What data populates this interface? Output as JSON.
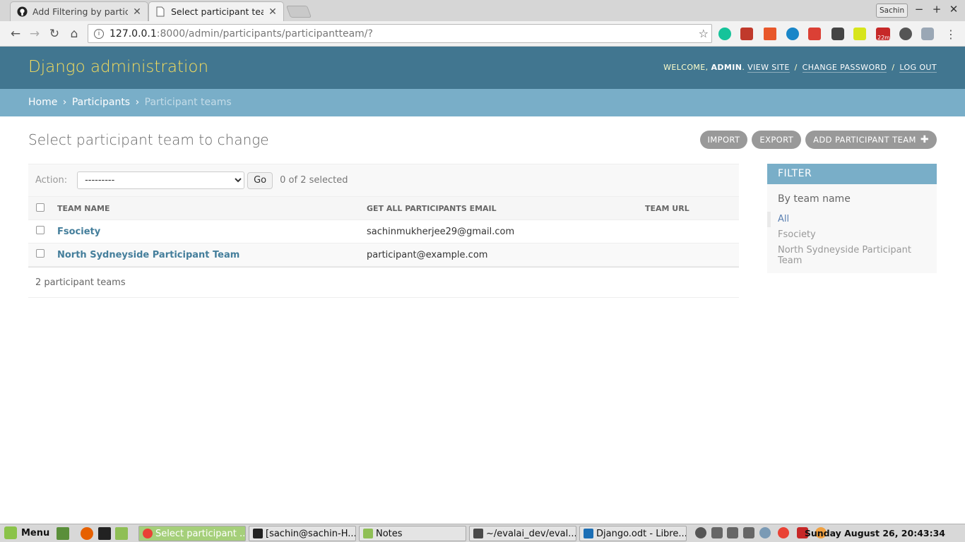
{
  "browser": {
    "tabs": [
      {
        "label": "Add Filtering by particip",
        "close": "✕"
      },
      {
        "label": "Select participant team t",
        "close": "✕"
      }
    ],
    "profile": "Sachin",
    "window_controls": {
      "minimize": "−",
      "maximize": "+",
      "close": "✕"
    },
    "url_host": "127.0.0.1",
    "url_path": ":8000/admin/participants/participantteam/?",
    "extension_badge": "22m"
  },
  "header": {
    "brand": "Django administration",
    "welcome": "Welcome,",
    "user": "admin",
    "view_site": "View site",
    "change_password": "Change password",
    "log_out": "Log out",
    "sep": "/"
  },
  "breadcrumbs": {
    "home": "Home",
    "app": "Participants",
    "current": "Participant teams",
    "sep": "›"
  },
  "page": {
    "title": "Select participant team to change",
    "import_label": "Import",
    "export_label": "Export",
    "add_label": "Add participant team"
  },
  "actions": {
    "label": "Action:",
    "selected": "---------",
    "go": "Go",
    "counter": "0 of 2 selected"
  },
  "table": {
    "headers": [
      "Team name",
      "Get all participants email",
      "Team URL"
    ],
    "rows": [
      {
        "name": "Fsociety",
        "email": "sachinmukherjee29@gmail.com",
        "url": ""
      },
      {
        "name": "North Sydneyside Participant Team",
        "email": "participant@example.com",
        "url": ""
      }
    ],
    "footer": "2 participant teams"
  },
  "filter": {
    "title": "Filter",
    "by": "By team name",
    "options": [
      "All",
      "Fsociety",
      "North Sydneyside Participant Team"
    ]
  },
  "taskbar": {
    "menu": "Menu",
    "windows": [
      "Select participant ...",
      "[sachin@sachin-H...",
      "Notes",
      "~/evalai_dev/eval...",
      "Django.odt - Libre..."
    ],
    "clock": "Sunday August 26, 20:43:34"
  },
  "colors": {
    "header": "#417690",
    "breadcrumb": "#79aec8",
    "brand": "#f5dd5d",
    "link": "#447e9b"
  }
}
